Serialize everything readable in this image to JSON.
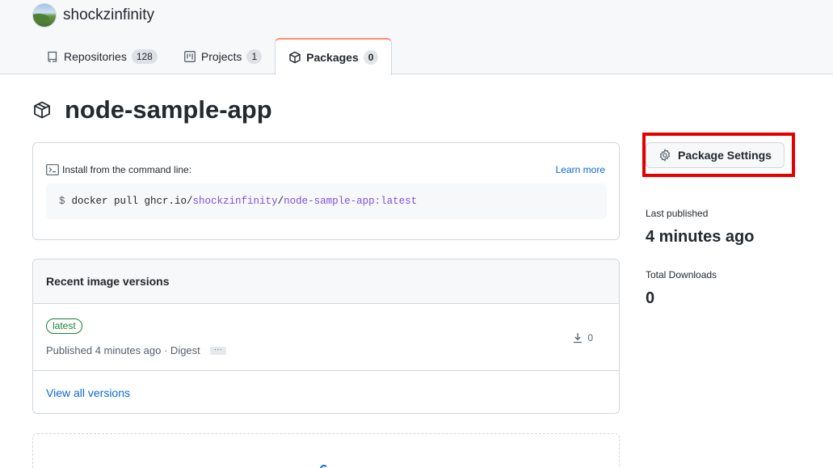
{
  "header": {
    "username": "shockzinfinity",
    "tabs": [
      {
        "label": "Repositories",
        "count": "128"
      },
      {
        "label": "Projects",
        "count": "1"
      },
      {
        "label": "Packages",
        "count": "0"
      }
    ]
  },
  "package": {
    "name": "node-sample-app"
  },
  "install": {
    "heading": "Install from the command line:",
    "learn_more": "Learn more",
    "prompt": "$",
    "cmd_prefix": "docker pull ghcr.io/",
    "cmd_owner": "shockzinfinity",
    "cmd_sep": "/",
    "cmd_image": "node-sample-app:latest"
  },
  "versions": {
    "heading": "Recent image versions",
    "items": [
      {
        "tag": "latest",
        "meta": "Published 4 minutes ago · Digest",
        "digest_toggle": "···",
        "downloads": "0"
      }
    ],
    "view_all": "View all versions"
  },
  "sidebar": {
    "settings_button": "Package Settings",
    "last_published_label": "Last published",
    "last_published_value": "4 minutes ago",
    "total_downloads_label": "Total Downloads",
    "total_downloads_value": "0"
  },
  "colors": {
    "accent_link": "#0969da",
    "highlight": "#e50000",
    "tab_active_border": "#fd8c73",
    "tag_green": "#1a7f37",
    "cmd_purple": "#8250df"
  }
}
